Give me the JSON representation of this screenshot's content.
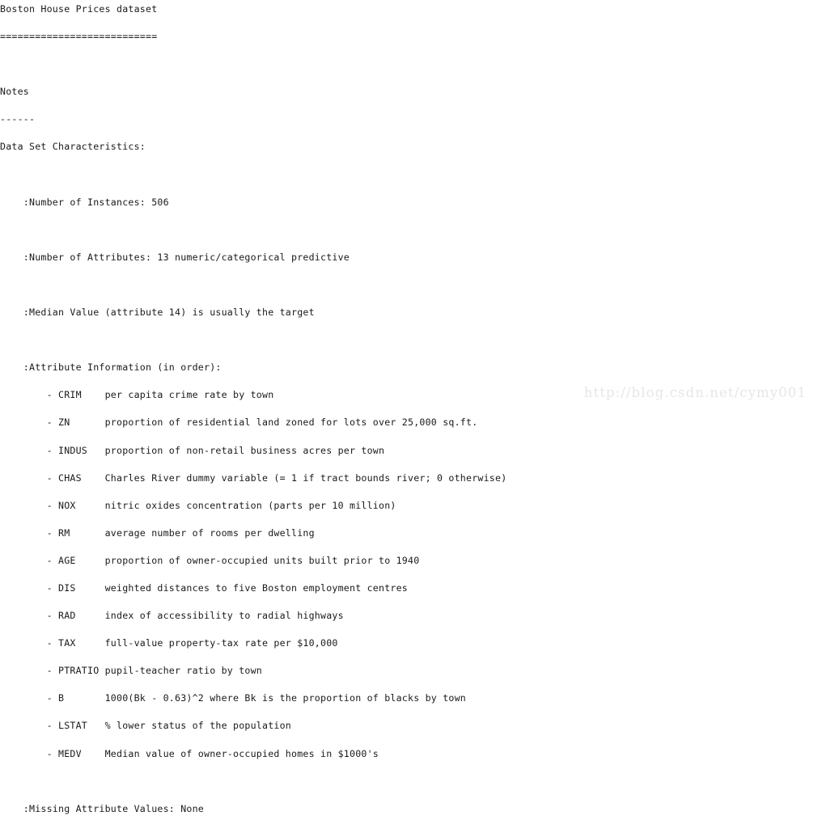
{
  "document": {
    "title": "Boston House Prices dataset",
    "title_underline": "===========================",
    "notes_heading": "Notes",
    "notes_underline": "------",
    "characteristics_heading": "Data Set Characteristics:",
    "fields": {
      "num_instances": ":Number of Instances: 506",
      "num_attributes": ":Number of Attributes: 13 numeric/categorical predictive",
      "median_value": ":Median Value (attribute 14) is usually the target",
      "attribute_information": ":Attribute Information (in order):",
      "missing_values": ":Missing Attribute Values: None"
    },
    "attributes": [
      {
        "name": "CRIM",
        "description": "per capita crime rate by town"
      },
      {
        "name": "ZN",
        "description": "proportion of residential land zoned for lots over 25,000 sq.ft."
      },
      {
        "name": "INDUS",
        "description": "proportion of non-retail business acres per town"
      },
      {
        "name": "CHAS",
        "description": "Charles River dummy variable (= 1 if tract bounds river; 0 otherwise)"
      },
      {
        "name": "NOX",
        "description": "nitric oxides concentration (parts per 10 million)"
      },
      {
        "name": "RM",
        "description": "average number of rooms per dwelling"
      },
      {
        "name": "AGE",
        "description": "proportion of owner-occupied units built prior to 1940"
      },
      {
        "name": "DIS",
        "description": "weighted distances to five Boston employment centres"
      },
      {
        "name": "RAD",
        "description": "index of accessibility to radial highways"
      },
      {
        "name": "TAX",
        "description": "full-value property-tax rate per $10,000"
      },
      {
        "name": "PTRATIO",
        "description": "pupil-teacher ratio by town"
      },
      {
        "name": "B",
        "description": "1000(Bk - 0.63)^2 where Bk is the proportion of blacks by town"
      },
      {
        "name": "LSTAT",
        "description": "% lower status of the population"
      },
      {
        "name": "MEDV",
        "description": "Median value of owner-occupied homes in $1000's"
      }
    ]
  },
  "watermark": {
    "text": "http://blog.csdn.net/cymy001",
    "color": "#e6e6e6"
  }
}
